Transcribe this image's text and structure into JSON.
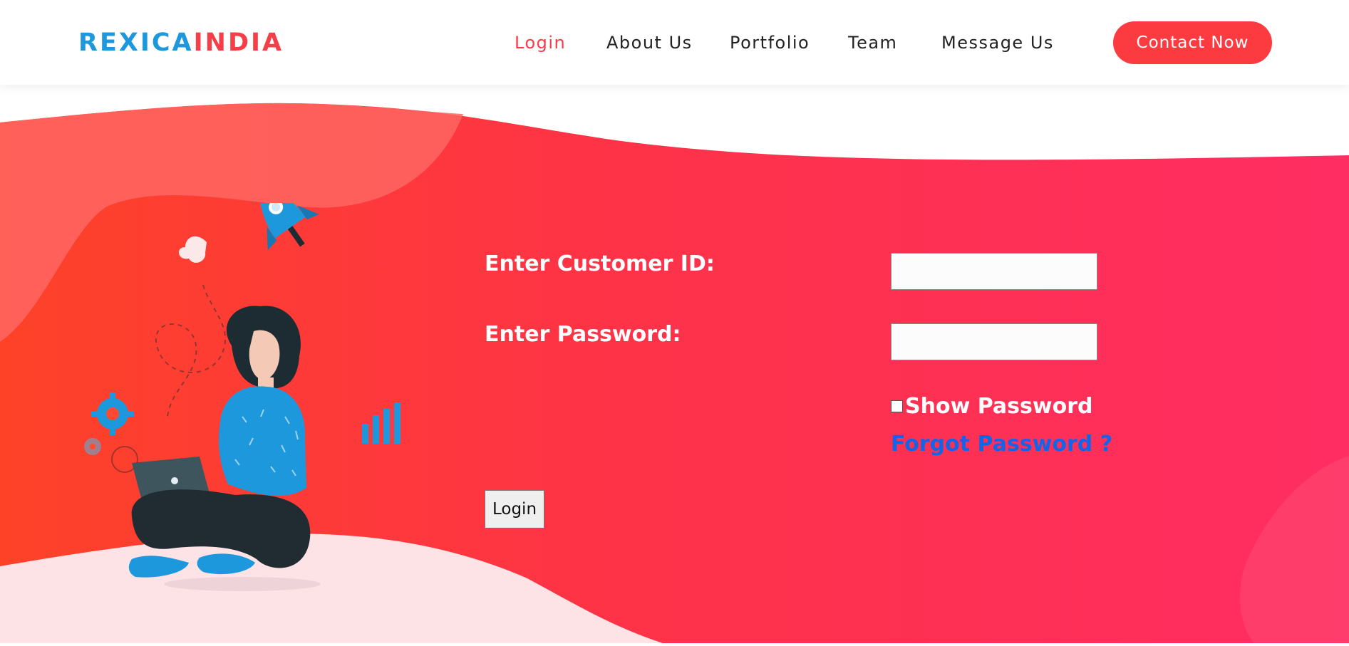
{
  "header": {
    "logo": {
      "part1": "REXICA",
      "part2": "INDIA"
    },
    "nav": [
      {
        "label": "Login",
        "active": true
      },
      {
        "label": "About Us",
        "active": false
      },
      {
        "label": "Portfolio",
        "active": false
      },
      {
        "label": "Team",
        "active": false
      },
      {
        "label": "Message Us",
        "active": false
      }
    ],
    "contact_button": "Contact Now"
  },
  "form": {
    "customer_id_label": "Enter Customer ID:",
    "customer_id_value": "",
    "password_label": "Enter Password:",
    "password_value": "",
    "show_password_label": "Show Password",
    "show_password_checked": false,
    "forgot_password": "Forgot Password ?",
    "login_button": "Login"
  },
  "colors": {
    "brand_blue": "#1e98dc",
    "brand_red": "#f53e47",
    "hero_gradient_start": "#fd4228",
    "hero_gradient_end": "#ff2d62",
    "link_blue": "#1264e8"
  },
  "icons": [
    "rocket-icon",
    "gear-icon",
    "bar-chart-icon",
    "laptop-icon"
  ]
}
